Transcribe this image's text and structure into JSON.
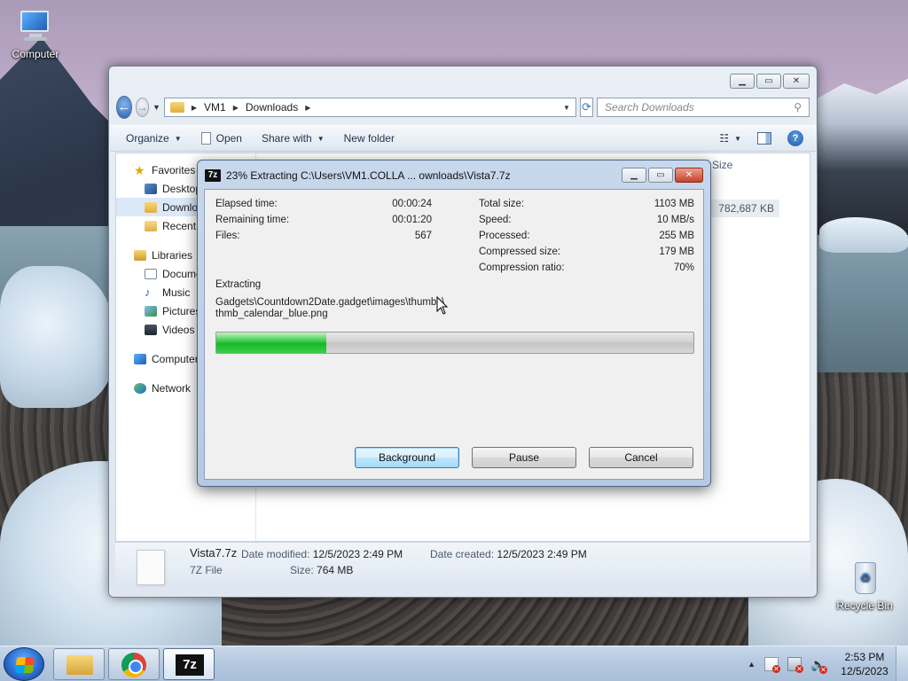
{
  "desktop": {
    "icons": [
      {
        "label": "Computer"
      },
      {
        "label": "Recycle Bin"
      }
    ]
  },
  "explorer": {
    "breadcrumb": [
      "VM1",
      "Downloads"
    ],
    "search_placeholder": "Search Downloads",
    "toolbar": {
      "organize": "Organize",
      "open": "Open",
      "share_with": "Share with",
      "new_folder": "New folder"
    },
    "nav": {
      "favorites": "Favorites",
      "desktop": "Desktop",
      "downloads": "Downloads",
      "recent": "Recent Places",
      "libraries": "Libraries",
      "documents": "Documents",
      "music": "Music",
      "pictures": "Pictures",
      "videos": "Videos",
      "computer": "Computer",
      "network": "Network"
    },
    "column_size": "Size",
    "file_size": "782,687 KB",
    "details": {
      "name": "Vista7.7z",
      "type": "7Z File",
      "date_modified_label": "Date modified:",
      "date_modified": "12/5/2023 2:49 PM",
      "date_created_label": "Date created:",
      "date_created": "12/5/2023 2:49 PM",
      "size_label": "Size:",
      "size": "764 MB"
    }
  },
  "sevenzip": {
    "title": "23% Extracting C:\\Users\\VM1.COLLA ... ownloads\\Vista7.7z",
    "logo": "7z",
    "left_stats": [
      {
        "label": "Elapsed time:",
        "value": "00:00:24"
      },
      {
        "label": "Remaining time:",
        "value": "00:01:20"
      },
      {
        "label": "Files:",
        "value": "567"
      }
    ],
    "right_stats": [
      {
        "label": "Total size:",
        "value": "1103 MB"
      },
      {
        "label": "Speed:",
        "value": "10 MB/s"
      },
      {
        "label": "Processed:",
        "value": "255 MB"
      },
      {
        "label": "Compressed size:",
        "value": "179 MB"
      },
      {
        "label": "Compression ratio:",
        "value": "70%"
      }
    ],
    "status_label": "Extracting",
    "current_path_line1": "Gadgets\\Countdown2Date.gadget\\images\\thumbs\\",
    "current_path_line2": "thmb_calendar_blue.png",
    "progress_percent": 23,
    "buttons": {
      "background": "Background",
      "pause": "Pause",
      "cancel": "Cancel"
    }
  },
  "taskbar": {
    "apps": [
      "windows-explorer",
      "google-chrome",
      "7-zip"
    ],
    "time": "2:53 PM",
    "date": "12/5/2023"
  }
}
